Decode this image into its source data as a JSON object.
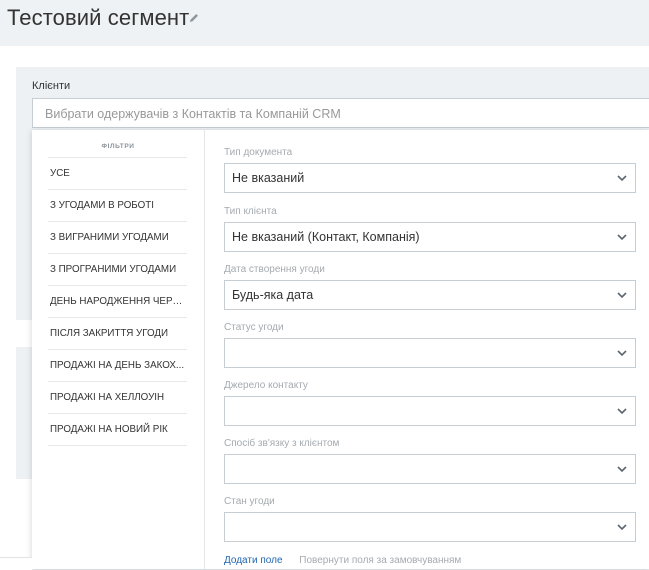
{
  "header": {
    "title": "Тестовий сегмент",
    "edit_icon": "pencil-icon"
  },
  "recipients": {
    "label": "Клієнти",
    "placeholder": "Вибрати одержувачів з Контактів та Компаній CRM"
  },
  "filters": {
    "title": "ФІЛЬТРИ",
    "items": [
      {
        "label": "УСЕ"
      },
      {
        "label": "З УГОДАМИ В РОБОТІ"
      },
      {
        "label": "З ВИГРАНИМИ УГОДАМИ"
      },
      {
        "label": "З ПРОГРАНИМИ УГОДАМИ"
      },
      {
        "label": "ДЕНЬ НАРОДЖЕННЯ ЧЕРЕ..."
      },
      {
        "label": "ПІСЛЯ ЗАКРИТТЯ УГОДИ"
      },
      {
        "label": "ПРОДАЖІ НА ДЕНЬ ЗАКОХ..."
      },
      {
        "label": "ПРОДАЖІ НА ХЕЛЛОУІН"
      },
      {
        "label": "ПРОДАЖІ НА НОВИЙ РІК"
      }
    ]
  },
  "fields": [
    {
      "label": "Тип документа",
      "value": "Не вказаний"
    },
    {
      "label": "Тип клієнта",
      "value": "Не вказаний (Контакт, Компанія)"
    },
    {
      "label": "Дата створення угоди",
      "value": "Будь-яка дата"
    },
    {
      "label": "Статус угоди",
      "value": ""
    },
    {
      "label": "Джерело контакту",
      "value": ""
    },
    {
      "label": "Спосіб зв'язку з клієнтом",
      "value": ""
    },
    {
      "label": "Стан угоди",
      "value": ""
    }
  ],
  "actions": {
    "add_field": "Додати поле",
    "reset_fields": "Повернути поля за замовчуванням"
  },
  "icons": {
    "dropdown": "chevron-down-icon"
  },
  "colors": {
    "link": "#2067b0",
    "muted_label": "#a5abb0",
    "page_bg": "#eef2f4"
  }
}
